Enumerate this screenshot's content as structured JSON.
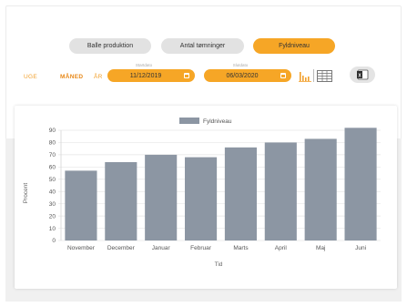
{
  "tabs": [
    {
      "label": "Balle produktion",
      "active": false
    },
    {
      "label": "Antal tømninger",
      "active": false
    },
    {
      "label": "Fyldniveau",
      "active": true
    }
  ],
  "periods": [
    {
      "label": "UGE",
      "active": false
    },
    {
      "label": "MÅNED",
      "active": true
    },
    {
      "label": "ÅR",
      "active": false
    }
  ],
  "start_date": {
    "caption": "Startdato",
    "value": "11/12/2019"
  },
  "end_date": {
    "caption": "Slutdato",
    "value": "06/03/2020"
  },
  "icons": {
    "chart_view": "bar-chart-icon",
    "table_view": "table-icon",
    "export": "excel-export-icon"
  },
  "colors": {
    "accent": "#f6a626",
    "bar": "#8c96a3",
    "tab_inactive": "#e2e2e2"
  },
  "chart_data": {
    "type": "bar",
    "categories": [
      "November",
      "December",
      "Januar",
      "Februar",
      "Marts",
      "April",
      "Maj",
      "Juni"
    ],
    "series": [
      {
        "name": "Fyldniveau",
        "values": [
          57,
          64,
          70,
          68,
          76,
          80,
          83,
          92
        ]
      }
    ],
    "xlabel": "Tid",
    "ylabel": "Procent",
    "ylim": [
      0,
      90
    ],
    "yticks": [
      0,
      10,
      20,
      30,
      40,
      50,
      60,
      70,
      80,
      90
    ],
    "grid": true,
    "legend": "top-center"
  }
}
